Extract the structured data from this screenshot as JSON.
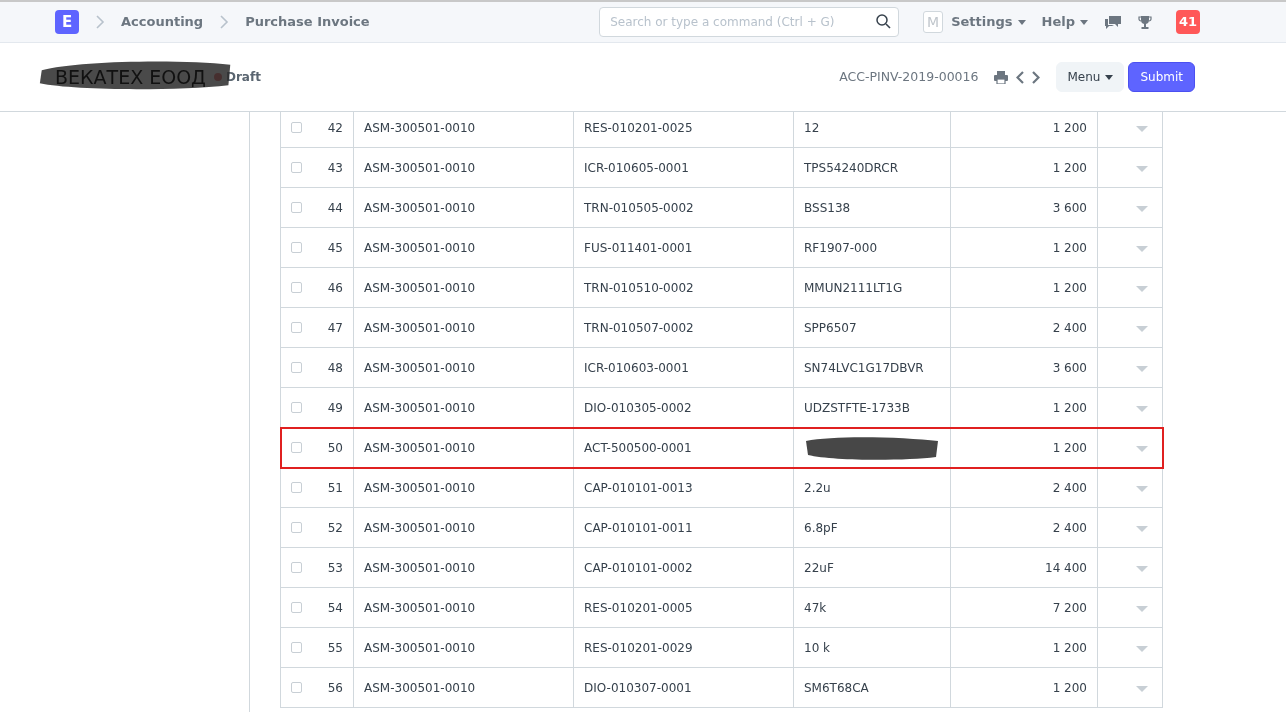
{
  "navbar": {
    "logo": "E",
    "breadcrumbs": [
      "Accounting",
      "Purchase Invoice"
    ],
    "search": {
      "placeholder": "Search or type a command (Ctrl + G)"
    },
    "avatar": "M",
    "menus": [
      "Settings",
      "Help"
    ],
    "notifications": "41"
  },
  "header": {
    "title": "ВЕКАТЕХ ЕООД",
    "title_redacted": true,
    "status": "Draft",
    "doc_id": "ACC-PINV-2019-00016",
    "buttons": [
      {
        "label": "Menu",
        "kind": "dropdown"
      },
      {
        "label": "Submit",
        "kind": "primary"
      }
    ]
  },
  "table": {
    "rows": [
      {
        "idx": "42",
        "checked": false,
        "highlighted": false,
        "column_2": "ASM-300501-0010",
        "column_3": "RES-010201-0025",
        "column_4": "12",
        "column_5": "1 200"
      },
      {
        "idx": "43",
        "checked": false,
        "highlighted": false,
        "column_2": "ASM-300501-0010",
        "column_3": "ICR-010605-0001",
        "column_4": "TPS54240DRCR",
        "column_5": "1 200"
      },
      {
        "idx": "44",
        "checked": false,
        "highlighted": false,
        "column_2": "ASM-300501-0010",
        "column_3": "TRN-010505-0002",
        "column_4": "BSS138",
        "column_5": "3 600"
      },
      {
        "idx": "45",
        "checked": false,
        "highlighted": false,
        "column_2": "ASM-300501-0010",
        "column_3": "FUS-011401-0001",
        "column_4": "RF1907-000",
        "column_5": "1 200"
      },
      {
        "idx": "46",
        "checked": false,
        "highlighted": false,
        "column_2": "ASM-300501-0010",
        "column_3": "TRN-010510-0002",
        "column_4": "MMUN2111LT1G",
        "column_5": "1 200"
      },
      {
        "idx": "47",
        "checked": false,
        "highlighted": false,
        "column_2": "ASM-300501-0010",
        "column_3": "TRN-010507-0002",
        "column_4": "SPP6507",
        "column_5": "2 400"
      },
      {
        "idx": "48",
        "checked": false,
        "highlighted": false,
        "column_2": "ASM-300501-0010",
        "column_3": "ICR-010603-0001",
        "column_4": "SN74LVC1G17DBVR",
        "column_5": "3 600"
      },
      {
        "idx": "49",
        "checked": false,
        "highlighted": false,
        "column_2": "ASM-300501-0010",
        "column_3": "DIO-010305-0002",
        "column_4": "UDZSTFTE-1733B",
        "column_5": "1 200"
      },
      {
        "idx": "50",
        "checked": false,
        "highlighted": true,
        "column_2": "ASM-300501-0010",
        "column_3": "ACT-500500-0001",
        "column_4_redacted": true,
        "column_5": "1 200"
      },
      {
        "idx": "51",
        "checked": false,
        "highlighted": false,
        "column_2": "ASM-300501-0010",
        "column_3": "CAP-010101-0013",
        "column_4": "2.2u",
        "column_5": "2 400"
      },
      {
        "idx": "52",
        "checked": false,
        "highlighted": false,
        "column_2": "ASM-300501-0010",
        "column_3": "CAP-010101-0011",
        "column_4": "6.8pF",
        "column_5": "2 400"
      },
      {
        "idx": "53",
        "checked": false,
        "highlighted": false,
        "column_2": "ASM-300501-0010",
        "column_3": "CAP-010101-0002",
        "column_4": "22uF",
        "column_5": "14 400"
      },
      {
        "idx": "54",
        "checked": false,
        "highlighted": false,
        "column_2": "ASM-300501-0010",
        "column_3": "RES-010201-0005",
        "column_4": "47k",
        "column_5": "7 200"
      },
      {
        "idx": "55",
        "checked": false,
        "highlighted": false,
        "column_2": "ASM-300501-0010",
        "column_3": "RES-010201-0029",
        "column_4": "10 k",
        "column_5": "1 200"
      },
      {
        "idx": "56",
        "checked": false,
        "highlighted": false,
        "column_2": "ASM-300501-0010",
        "column_3": "DIO-010307-0001",
        "column_4": "SM6T68CA",
        "column_5": "1 200"
      }
    ]
  }
}
